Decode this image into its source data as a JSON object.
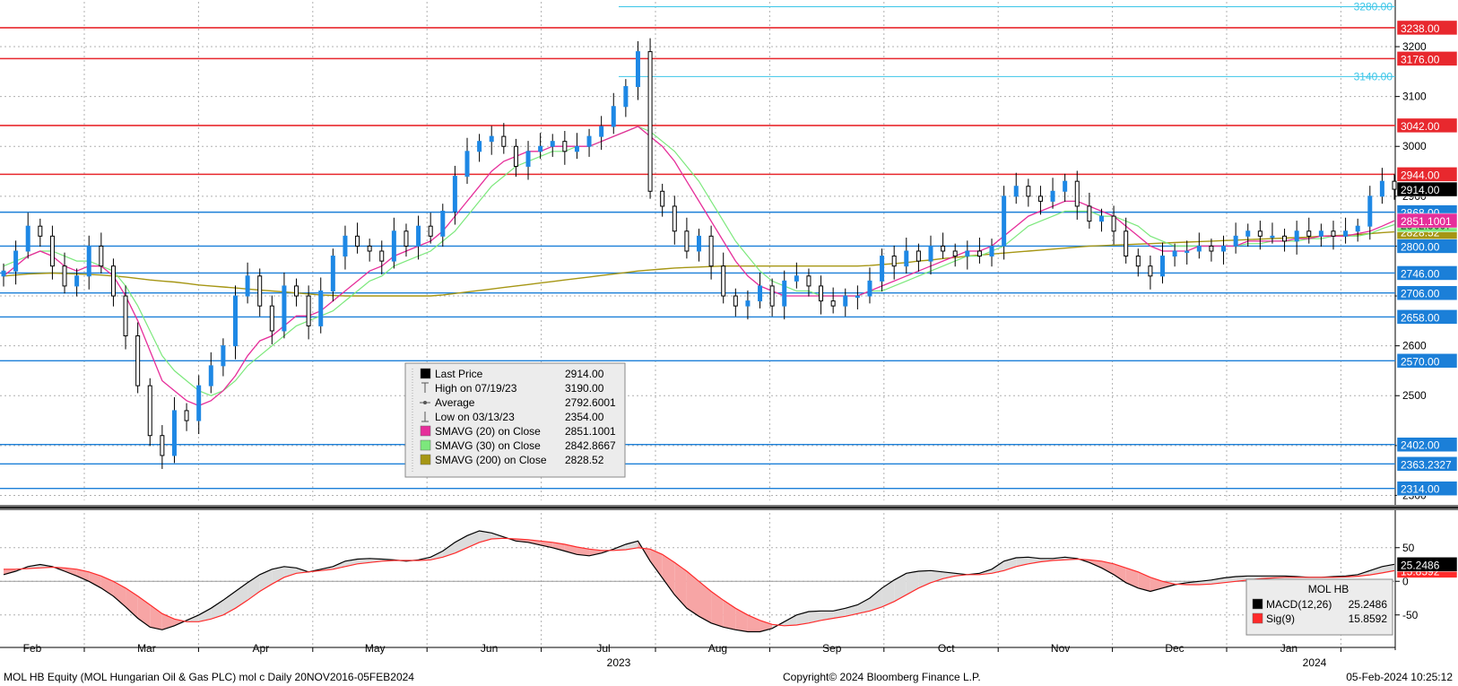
{
  "chart_data": [
    {
      "type": "line",
      "subtype": "candlestick-price-chart",
      "y_axis_side": "right",
      "ylim": [
        2290,
        3290
      ],
      "y_ticks": [
        "2300",
        "2400",
        "2500",
        "2600",
        "2700",
        "2800",
        "2900",
        "3000",
        "3100",
        "3200"
      ],
      "x_month_labels": [
        "Feb",
        "Mar",
        "Apr",
        "May",
        "Jun",
        "Jul",
        "Aug",
        "Sep",
        "Oct",
        "Nov",
        "Dec",
        "Jan"
      ],
      "x_year_labels": [
        "2023",
        "2024"
      ],
      "grid": true,
      "resistance_lines": [
        {
          "value": 3238.0,
          "label": "3238.00"
        },
        {
          "value": 3176.0,
          "label": "3176.00"
        },
        {
          "value": 3042.0,
          "label": "3042.00"
        },
        {
          "value": 2944.0,
          "label": "2944.00"
        }
      ],
      "support_lines": [
        {
          "value": 2868.0,
          "label": "2868.00"
        },
        {
          "value": 2800.0,
          "label": "2800.00"
        },
        {
          "value": 2746.0,
          "label": "2746.00"
        },
        {
          "value": 2706.0,
          "label": "2706.00"
        },
        {
          "value": 2658.0,
          "label": "2658.00"
        },
        {
          "value": 2570.0,
          "label": "2570.00"
        },
        {
          "value": 2402.0,
          "label": "2402.00"
        },
        {
          "value": 2363.2327,
          "label": "2363.2327"
        },
        {
          "value": 2314.0,
          "label": "2314.00"
        }
      ],
      "chart_annotations": [
        {
          "value": 3140.0,
          "label": "3140.00"
        },
        {
          "value": 3280.0,
          "label": "3280.00"
        }
      ],
      "last_price_tag": {
        "value": 2914.0,
        "label": "2914.00"
      },
      "sma_tags": [
        {
          "value": 2851.1001,
          "label": "2851.1001",
          "color": "#e62e9a"
        },
        {
          "value": 2842.8667,
          "label": "2842.8667",
          "color": "#7ce87c"
        },
        {
          "value": 2828.52,
          "label": "2828.52",
          "color": "#a69614"
        }
      ],
      "legend": {
        "placement": "center-left",
        "items": [
          {
            "marker": "#000000",
            "label": "Last Price",
            "value": "2914.00"
          },
          {
            "marker": "high-icon",
            "label": "High on 07/19/23",
            "value": "3190.00"
          },
          {
            "marker": "average-icon",
            "label": "Average",
            "value": "2792.6001"
          },
          {
            "marker": "low-icon",
            "label": "Low on 03/13/23",
            "value": "2354.00"
          },
          {
            "marker": "#e62e9a",
            "label": "SMAVG (20)  on Close",
            "value": "2851.1001"
          },
          {
            "marker": "#7ce87c",
            "label": "SMAVG (30)  on Close",
            "value": "2842.8667"
          },
          {
            "marker": "#a69614",
            "label": "SMAVG (200)  on Close",
            "value": "2828.52"
          }
        ]
      },
      "close_series": [
        2750,
        2790,
        2840,
        2820,
        2760,
        2720,
        2740,
        2800,
        2760,
        2700,
        2620,
        2520,
        2420,
        2380,
        2470,
        2450,
        2520,
        2560,
        2600,
        2700,
        2740,
        2680,
        2630,
        2720,
        2700,
        2640,
        2710,
        2780,
        2820,
        2800,
        2790,
        2770,
        2830,
        2800,
        2840,
        2820,
        2870,
        2940,
        2990,
        3010,
        3020,
        3000,
        2960,
        2990,
        3000,
        3010,
        2990,
        3000,
        3020,
        3040,
        3080,
        3120,
        3190,
        2910,
        2880,
        2830,
        2790,
        2820,
        2760,
        2700,
        2680,
        2690,
        2720,
        2680,
        2730,
        2740,
        2720,
        2690,
        2680,
        2700,
        2700,
        2730,
        2780,
        2760,
        2790,
        2770,
        2800,
        2790,
        2780,
        2790,
        2780,
        2800,
        2900,
        2920,
        2900,
        2890,
        2910,
        2930,
        2880,
        2850,
        2860,
        2830,
        2780,
        2760,
        2740,
        2780,
        2790,
        2790,
        2800,
        2790,
        2800,
        2820,
        2830,
        2820,
        2820,
        2810,
        2830,
        2820,
        2830,
        2820,
        2830,
        2840,
        2900,
        2930,
        2914
      ],
      "sma20_series": [
        2740,
        2760,
        2780,
        2790,
        2780,
        2760,
        2750,
        2760,
        2760,
        2740,
        2700,
        2650,
        2590,
        2530,
        2510,
        2490,
        2480,
        2490,
        2510,
        2540,
        2580,
        2610,
        2620,
        2640,
        2660,
        2660,
        2670,
        2690,
        2710,
        2730,
        2750,
        2760,
        2780,
        2790,
        2800,
        2810,
        2830,
        2860,
        2890,
        2920,
        2950,
        2970,
        2980,
        2990,
        2990,
        3000,
        3000,
        3000,
        3000,
        3010,
        3020,
        3030,
        3040,
        3020,
        3000,
        2970,
        2930,
        2890,
        2850,
        2810,
        2770,
        2740,
        2720,
        2710,
        2700,
        2700,
        2700,
        2700,
        2700,
        2700,
        2700,
        2710,
        2720,
        2730,
        2740,
        2750,
        2760,
        2770,
        2780,
        2790,
        2790,
        2800,
        2820,
        2840,
        2860,
        2870,
        2880,
        2890,
        2890,
        2880,
        2870,
        2860,
        2840,
        2820,
        2800,
        2790,
        2790,
        2790,
        2800,
        2800,
        2800,
        2800,
        2810,
        2810,
        2810,
        2810,
        2815,
        2815,
        2820,
        2820,
        2820,
        2825,
        2830,
        2840,
        2851
      ],
      "sma30_series": [
        2760,
        2770,
        2780,
        2790,
        2790,
        2780,
        2770,
        2770,
        2760,
        2750,
        2720,
        2680,
        2630,
        2580,
        2550,
        2530,
        2510,
        2500,
        2510,
        2530,
        2560,
        2580,
        2600,
        2620,
        2640,
        2650,
        2660,
        2670,
        2690,
        2710,
        2730,
        2740,
        2760,
        2770,
        2780,
        2790,
        2810,
        2830,
        2860,
        2890,
        2920,
        2940,
        2960,
        2970,
        2980,
        2990,
        2990,
        3000,
        3000,
        3010,
        3020,
        3030,
        3040,
        3030,
        3010,
        2990,
        2960,
        2930,
        2890,
        2850,
        2810,
        2780,
        2750,
        2730,
        2720,
        2710,
        2710,
        2700,
        2700,
        2700,
        2700,
        2710,
        2710,
        2720,
        2730,
        2740,
        2750,
        2760,
        2770,
        2780,
        2780,
        2790,
        2800,
        2820,
        2840,
        2850,
        2860,
        2870,
        2870,
        2870,
        2860,
        2860,
        2850,
        2840,
        2820,
        2810,
        2800,
        2800,
        2800,
        2800,
        2800,
        2800,
        2805,
        2805,
        2810,
        2810,
        2810,
        2815,
        2815,
        2820,
        2820,
        2820,
        2825,
        2835,
        2843
      ],
      "sma200_series": [
        2740,
        2742,
        2744,
        2745,
        2746,
        2745,
        2744,
        2743,
        2742,
        2740,
        2738,
        2735,
        2732,
        2730,
        2728,
        2725,
        2722,
        2720,
        2718,
        2716,
        2714,
        2712,
        2710,
        2708,
        2706,
        2704,
        2702,
        2701,
        2700,
        2700,
        2700,
        2700,
        2700,
        2700,
        2700,
        2700,
        2702,
        2705,
        2708,
        2711,
        2714,
        2717,
        2720,
        2723,
        2726,
        2729,
        2732,
        2735,
        2738,
        2741,
        2744,
        2747,
        2750,
        2752,
        2754,
        2756,
        2757,
        2758,
        2759,
        2760,
        2760,
        2760,
        2760,
        2760,
        2760,
        2760,
        2760,
        2760,
        2760,
        2760,
        2760,
        2761,
        2763,
        2765,
        2767,
        2770,
        2772,
        2775,
        2777,
        2780,
        2782,
        2784,
        2786,
        2788,
        2790,
        2792,
        2794,
        2796,
        2798,
        2800,
        2801,
        2802,
        2803,
        2804,
        2805,
        2806,
        2807,
        2808,
        2809,
        2810,
        2811,
        2812,
        2813,
        2814,
        2815,
        2816,
        2817,
        2818,
        2820,
        2821,
        2822,
        2823,
        2825,
        2827,
        2828.52
      ]
    },
    {
      "type": "area",
      "name_title": "MOL HB",
      "ylim": [
        -85,
        75
      ],
      "y_ticks": [
        "50",
        "0",
        "-50"
      ],
      "legend": {
        "placement": "bottom-right",
        "items": [
          {
            "marker": "#000000",
            "label": "MACD(12,26)",
            "value": "25.2486"
          },
          {
            "marker": "#ff2a2a",
            "label": "Sig(9)",
            "value": "15.8592"
          }
        ]
      },
      "last_tags": [
        {
          "value": 25.2486,
          "label": "25.2486",
          "color": "#000000"
        },
        {
          "value": 15.8592,
          "label": "15.8592",
          "color": "#ff2a2a"
        }
      ],
      "macd_series": [
        10,
        15,
        22,
        25,
        22,
        15,
        8,
        0,
        -10,
        -22,
        -38,
        -55,
        -68,
        -72,
        -66,
        -58,
        -50,
        -40,
        -28,
        -15,
        -2,
        10,
        18,
        22,
        20,
        14,
        18,
        22,
        30,
        33,
        34,
        33,
        32,
        30,
        32,
        36,
        45,
        58,
        68,
        75,
        72,
        66,
        60,
        58,
        54,
        50,
        45,
        40,
        38,
        42,
        48,
        55,
        60,
        30,
        5,
        -20,
        -40,
        -52,
        -62,
        -68,
        -72,
        -75,
        -75,
        -70,
        -60,
        -50,
        -45,
        -44,
        -44,
        -40,
        -35,
        -25,
        -10,
        2,
        12,
        15,
        16,
        14,
        12,
        10,
        12,
        18,
        30,
        35,
        36,
        34,
        34,
        36,
        34,
        28,
        20,
        10,
        -2,
        -10,
        -15,
        -10,
        -5,
        -2,
        0,
        2,
        5,
        7,
        8,
        8,
        8,
        8,
        7,
        6,
        6,
        7,
        8,
        10,
        16,
        22,
        25.2486
      ],
      "signal_series": [
        18,
        18,
        19,
        20,
        21,
        20,
        18,
        14,
        8,
        0,
        -10,
        -22,
        -35,
        -48,
        -56,
        -60,
        -60,
        -56,
        -50,
        -40,
        -28,
        -15,
        -4,
        6,
        12,
        14,
        16,
        18,
        22,
        26,
        28,
        30,
        31,
        31,
        31,
        32,
        36,
        42,
        50,
        58,
        63,
        64,
        63,
        62,
        60,
        58,
        55,
        51,
        48,
        46,
        46,
        47,
        50,
        48,
        40,
        28,
        15,
        0,
        -15,
        -28,
        -40,
        -50,
        -58,
        -64,
        -66,
        -65,
        -62,
        -58,
        -55,
        -52,
        -48,
        -44,
        -38,
        -30,
        -20,
        -10,
        -2,
        4,
        8,
        10,
        10,
        12,
        16,
        22,
        26,
        29,
        31,
        32,
        33,
        32,
        30,
        26,
        20,
        14,
        6,
        0,
        -4,
        -5,
        -5,
        -4,
        -2,
        0,
        2,
        4,
        5,
        6,
        6,
        6,
        6,
        6,
        6.5,
        7.5,
        9.5,
        12.5,
        15.8592
      ]
    }
  ],
  "footer": {
    "left": "MOL HB Equity (MOL Hungarian Oil & Gas PLC) mol c  Daily 20NOV2016-05FEB2024",
    "center": "Copyright© 2024 Bloomberg Finance L.P.",
    "right": "05-Feb-2024 10:25:12"
  },
  "colors": {
    "up_candle": "#1e88e5",
    "down_candle": "#000000",
    "resistance": "#e8282e",
    "support": "#1b7fd8",
    "annotation": "#3cc6e8",
    "macd_fill_above": "#dcdcdc",
    "macd_fill_below": "#f7a5a5"
  }
}
